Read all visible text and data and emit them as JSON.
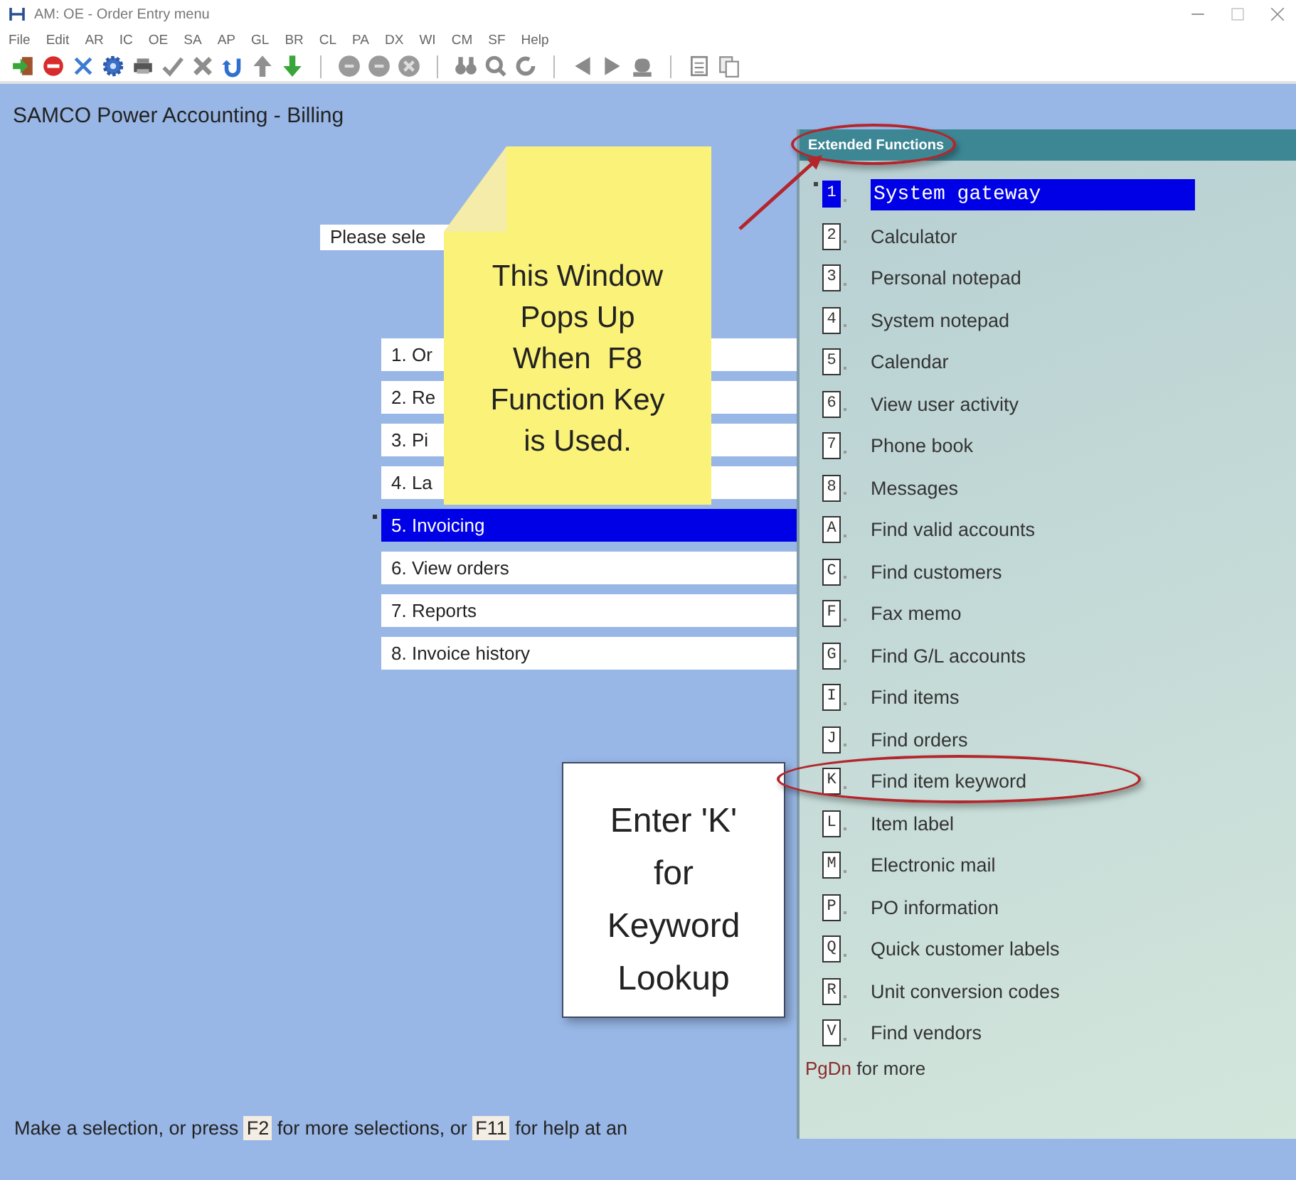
{
  "window": {
    "title": "AM: OE - Order Entry menu"
  },
  "menu_bar": [
    "File",
    "Edit",
    "AR",
    "IC",
    "OE",
    "SA",
    "AP",
    "GL",
    "BR",
    "CL",
    "PA",
    "DX",
    "WI",
    "CM",
    "SF",
    "Help"
  ],
  "screen": {
    "title": "SAMCO Power Accounting - Billing",
    "prompt": {
      "value": "Please sele"
    },
    "menu_items": [
      {
        "label": "1. Or",
        "selected": false
      },
      {
        "label": "2. Re",
        "selected": false
      },
      {
        "label": "3. Pi",
        "selected": false
      },
      {
        "label": "4. La",
        "selected": false
      },
      {
        "label": "5. Invoicing",
        "selected": true
      },
      {
        "label": "6. View orders",
        "selected": false
      },
      {
        "label": "7. Reports",
        "selected": false
      },
      {
        "label": "8. Invoice history",
        "selected": false
      }
    ],
    "status_message": [
      {
        "kind": "text",
        "text": "Make a selection, or press "
      },
      {
        "kind": "key",
        "text": "F2"
      },
      {
        "kind": "text",
        "text": " for more selections, or "
      },
      {
        "kind": "key",
        "text": "F11"
      },
      {
        "kind": "text",
        "text": " for help at an"
      }
    ]
  },
  "extended_functions": {
    "title": "Extended Functions",
    "title_circled": true,
    "items": [
      {
        "key": "1",
        "label": "System gateway",
        "selected": true,
        "circled": false
      },
      {
        "key": "2",
        "label": "Calculator",
        "selected": false,
        "circled": false
      },
      {
        "key": "3",
        "label": "Personal notepad",
        "selected": false,
        "circled": false
      },
      {
        "key": "4",
        "label": "System notepad",
        "selected": false,
        "circled": false
      },
      {
        "key": "5",
        "label": "Calendar",
        "selected": false,
        "circled": false
      },
      {
        "key": "6",
        "label": "View user activity",
        "selected": false,
        "circled": false
      },
      {
        "key": "7",
        "label": "Phone book",
        "selected": false,
        "circled": false
      },
      {
        "key": "8",
        "label": "Messages",
        "selected": false,
        "circled": false
      },
      {
        "key": "A",
        "label": "Find valid accounts",
        "selected": false,
        "circled": false
      },
      {
        "key": "C",
        "label": "Find customers",
        "selected": false,
        "circled": false
      },
      {
        "key": "F",
        "label": "Fax memo",
        "selected": false,
        "circled": false
      },
      {
        "key": "G",
        "label": "Find G/L accounts",
        "selected": false,
        "circled": false
      },
      {
        "key": "I",
        "label": "Find items",
        "selected": false,
        "circled": false
      },
      {
        "key": "J",
        "label": "Find orders",
        "selected": false,
        "circled": false
      },
      {
        "key": "K",
        "label": "Find item keyword",
        "selected": false,
        "circled": true
      },
      {
        "key": "L",
        "label": "Item label",
        "selected": false,
        "circled": false
      },
      {
        "key": "M",
        "label": "Electronic mail",
        "selected": false,
        "circled": false
      },
      {
        "key": "P",
        "label": "PO information",
        "selected": false,
        "circled": false
      },
      {
        "key": "Q",
        "label": "Quick customer labels",
        "selected": false,
        "circled": false
      },
      {
        "key": "R",
        "label": "Unit conversion codes",
        "selected": false,
        "circled": false
      },
      {
        "key": "V",
        "label": "Find vendors",
        "selected": false,
        "circled": false
      }
    ],
    "more_hint": {
      "key": "PgDn",
      "text": "for more"
    }
  },
  "annotations": [
    {
      "kind": "sticky-note",
      "text": "This Window\nPops Up\nWhen  F8\nFunction Key\nis Used.",
      "arrow": true
    },
    {
      "kind": "callout",
      "text": "Enter 'K'\nfor\nKeyword\nLookup"
    }
  ]
}
